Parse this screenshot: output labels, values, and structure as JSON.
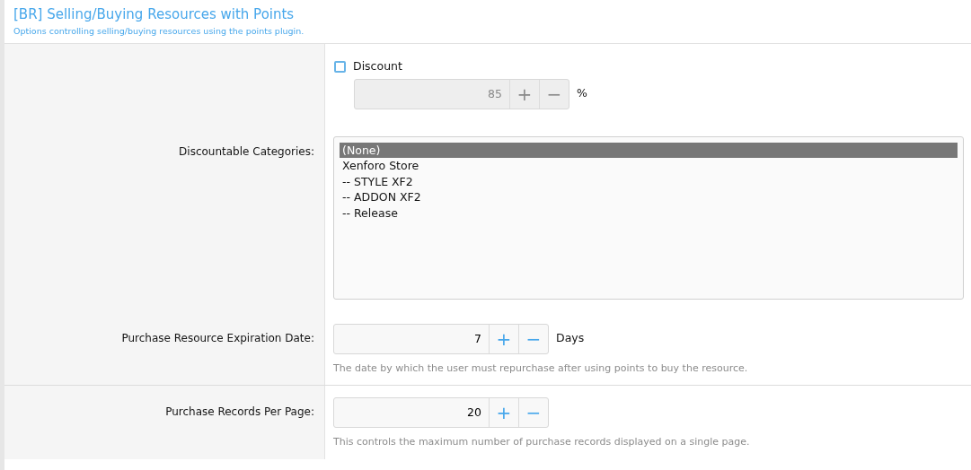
{
  "header": {
    "title": "[BR] Selling/Buying Resources with Points",
    "description": "Options controlling selling/buying resources using the points plugin."
  },
  "rows": [
    {
      "kind": "checkbox-spinner",
      "label": "",
      "checkbox": {
        "label": "Discount",
        "checked": false
      },
      "value": "85",
      "unit": "%",
      "plus": "+",
      "minus": "−"
    },
    {
      "kind": "listbox",
      "label": "Discountable Categories:",
      "options": [
        {
          "text": "(None)",
          "selected": true
        },
        {
          "text": "Xenforo Store",
          "selected": false
        },
        {
          "text": "-- STYLE XF2",
          "selected": false
        },
        {
          "text": "-- ADDON XF2",
          "selected": false
        },
        {
          "text": "-- Release",
          "selected": false
        }
      ]
    },
    {
      "kind": "spinner",
      "label": "Purchase Resource Expiration Date:",
      "value": "7",
      "unit": "Days",
      "plus": "+",
      "minus": "−",
      "hint": "The date by which the user must repurchase after using points to buy the resource."
    },
    {
      "kind": "spinner",
      "label": "Purchase Records Per Page:",
      "value": "20",
      "plus": "+",
      "minus": "−",
      "hint": "This controls the maximum number of purchase records displayed on a single page."
    }
  ]
}
